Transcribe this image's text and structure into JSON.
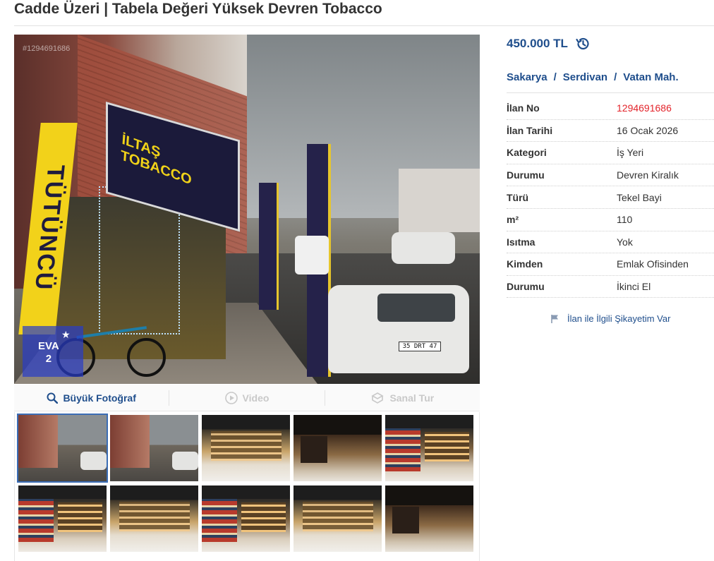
{
  "listing": {
    "title": "Cadde Üzeri | Tabela Değeri Yüksek Devren Tobacco",
    "price": "450.000 TL",
    "breadcrumb": [
      "Sakarya",
      "Serdivan",
      "Vatan Mah."
    ],
    "breadcrumb_separator": "/",
    "details": [
      {
        "label": "İlan No",
        "value": "1294691686"
      },
      {
        "label": "İlan Tarihi",
        "value": "16 Ocak 2026"
      },
      {
        "label": "Kategori",
        "value": "İş Yeri"
      },
      {
        "label": "Durumu",
        "value": "Devren Kiralık"
      },
      {
        "label": "Türü",
        "value": "Tekel Bayi"
      },
      {
        "label": "m²",
        "value": "110"
      },
      {
        "label": "Isıtma",
        "value": "Yok"
      },
      {
        "label": "Kimden",
        "value": "Emlak Ofisinden"
      },
      {
        "label": "Durumu",
        "value": "İkinci El"
      }
    ],
    "report_link": "İlan ile İlgili Şikayetim Var"
  },
  "photo": {
    "watermark_id": "#1294691686",
    "eva_badge": "EVA\n2",
    "banner_text": "TÜTÜNCÜ",
    "shop_sign": "İLTAŞ TOBACCO",
    "car_plate": "35 DRT 47"
  },
  "media": {
    "big_photo": "Büyük Fotoğraf",
    "video": "Video",
    "virtual_tour": "Sanal Tur"
  },
  "colors": {
    "brand_blue": "#1f4e8c",
    "ad_number_red": "#e3242b"
  }
}
